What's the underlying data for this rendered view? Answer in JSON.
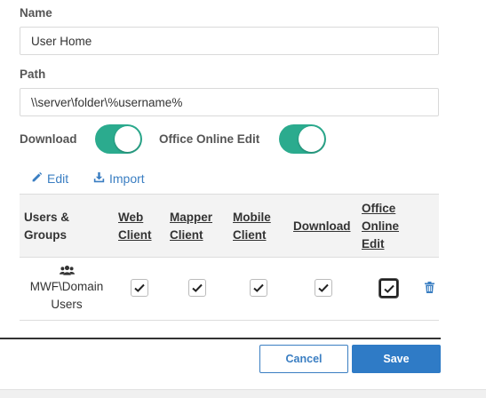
{
  "form": {
    "name_label": "Name",
    "name_value": "User Home",
    "path_label": "Path",
    "path_value": "\\\\server\\folder\\%username%",
    "download_label": "Download",
    "download_on": true,
    "office_label": "Office Online Edit",
    "office_on": true,
    "toggle_color": "#2bab8e"
  },
  "actions": {
    "edit_label": "Edit",
    "import_label": "Import",
    "link_color": "#3a7ec2"
  },
  "table": {
    "headers": {
      "users_groups": [
        "Users &",
        "Groups"
      ],
      "web_client": [
        "Web",
        "Client"
      ],
      "mapper_client": [
        "Mapper",
        "Client"
      ],
      "mobile_client": [
        "Mobile",
        "Client"
      ],
      "download": [
        "Download"
      ],
      "office_online_edit": [
        "Office",
        "Online",
        "Edit"
      ]
    },
    "rows": [
      {
        "group_icon": "users-icon",
        "group_name": [
          "MWF\\Domain",
          "Users"
        ],
        "web_client": true,
        "mapper_client": true,
        "mobile_client": true,
        "download": true,
        "office_online_edit": true,
        "delete_icon": "trash-icon"
      }
    ]
  },
  "footer": {
    "cancel_label": "Cancel",
    "save_label": "Save",
    "primary_color": "#2f7bc6"
  }
}
